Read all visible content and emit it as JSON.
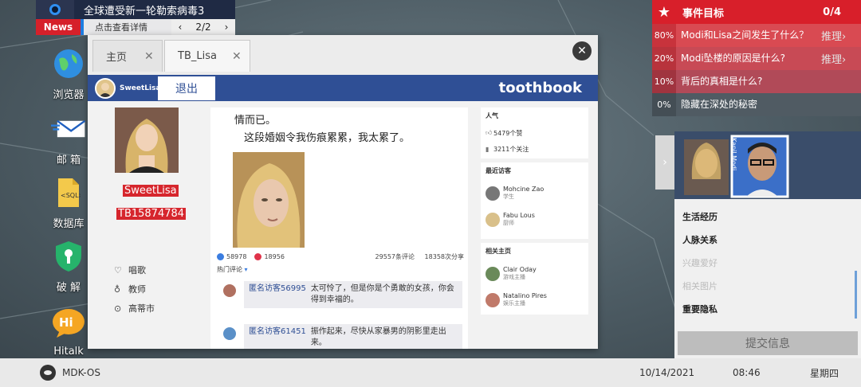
{
  "news": {
    "headline": "全球遭受新一轮勒索病毒3",
    "tag": "News",
    "detail": "点击查看详情",
    "pager": "2/2"
  },
  "desktop_icons": [
    {
      "label": "浏览器",
      "icon": "globe-icon"
    },
    {
      "label": "邮 箱",
      "icon": "mail-icon"
    },
    {
      "label": "数据库",
      "icon": "database-icon"
    },
    {
      "label": "破 解",
      "icon": "shield-key-icon"
    },
    {
      "label": "Hitalk",
      "icon": "chat-icon"
    }
  ],
  "browser": {
    "tabs": [
      {
        "label": "主页"
      },
      {
        "label": "TB_Lisa"
      }
    ],
    "header": {
      "username": "SweetLisa",
      "logout": "退出",
      "brand": "toothbook"
    },
    "profile": {
      "name": "SweetLisa",
      "id": "TB15874784",
      "info": [
        {
          "icon": "heart-icon",
          "text": "唱歌"
        },
        {
          "icon": "tie-icon",
          "text": "教师"
        },
        {
          "icon": "location-icon",
          "text": "高蒂市"
        }
      ]
    },
    "post": {
      "text_line1": "情而已。",
      "text_line2": "这段婚姻令我伤痕累累，我太累了。",
      "likes": "58978",
      "hearts": "18956",
      "comments": "29557条评论",
      "shares": "18358次分享",
      "hot_label": "热门评论",
      "comment_list": [
        {
          "name": "匿名访客56995",
          "text": "太可怜了，但是你是个勇敢的女孩，你会得到幸福的。"
        },
        {
          "name": "匿名访客61451",
          "text": "振作起来，尽快从家暴男的阴影里走出来。"
        }
      ]
    },
    "sidebar": {
      "popularity_title": "人气",
      "likes": "5479个赞",
      "follows": "3211个关注",
      "visitors_title": "最近访客",
      "visitors": [
        {
          "name": "Mohcine Zao",
          "role": "学生"
        },
        {
          "name": "Fabu Lous",
          "role": "厨师"
        }
      ],
      "related_title": "相关主页",
      "related": [
        {
          "name": "Clair Oday",
          "role": "游戏主播"
        },
        {
          "name": "Natalino Pires",
          "role": "娱乐主播"
        }
      ]
    }
  },
  "events": {
    "title": "事件目标",
    "count": "0/4",
    "items": [
      {
        "pct": "80%",
        "question": "Modi和Lisa之间发生了什么？",
        "infer": "推理›"
      },
      {
        "pct": "20%",
        "question": "Modi坠楼的原因是什么?",
        "infer": "推理›"
      },
      {
        "pct": "10%",
        "question": "背后的真相是什么?",
        "infer": ""
      },
      {
        "pct": "0%",
        "question": "隐藏在深处的秘密",
        "infer": ""
      }
    ]
  },
  "rpanel": {
    "banner_name": "Kapil Modi",
    "items": [
      {
        "text": "生活经历",
        "style": "bold"
      },
      {
        "text": "人脉关系",
        "style": "bold"
      },
      {
        "text": "兴趣爱好",
        "style": "dim"
      },
      {
        "text": "相关图片",
        "style": "dim"
      },
      {
        "text": "重要隐私",
        "style": "bold"
      }
    ],
    "submit": "提交信息"
  },
  "taskbar": {
    "os_name": "MDK-OS",
    "date": "10/14/2021",
    "time": "08:46",
    "day": "星期四"
  },
  "colors": {
    "accent_red": "#d81f2a",
    "toothbook_blue": "#2f4f95"
  }
}
